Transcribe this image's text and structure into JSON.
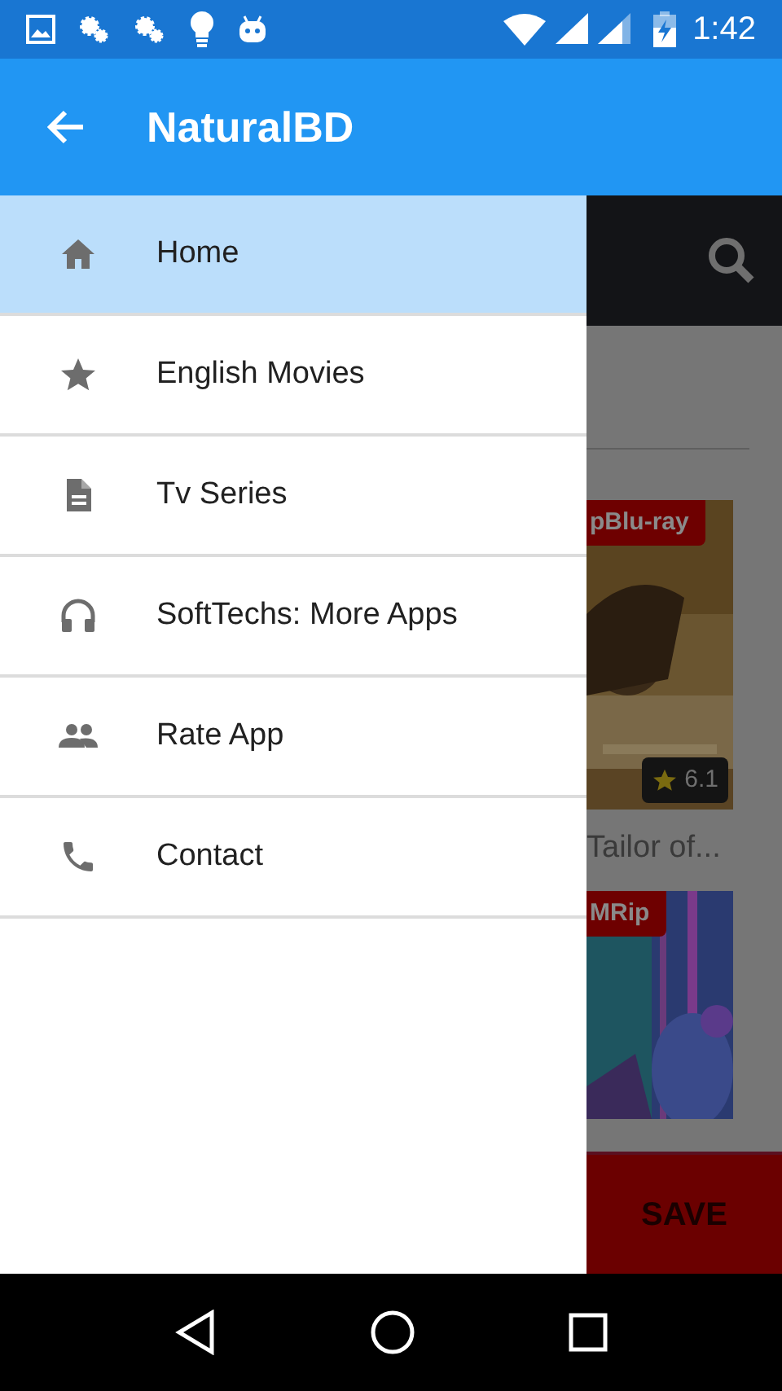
{
  "status_bar": {
    "time": "1:42"
  },
  "app_bar": {
    "title": "NaturalBD"
  },
  "drawer": {
    "items": [
      {
        "label": "Home",
        "selected": true
      },
      {
        "label": "English Movies",
        "selected": false
      },
      {
        "label": "Tv Series",
        "selected": false
      },
      {
        "label": "SoftTechs: More Apps",
        "selected": false
      },
      {
        "label": "Rate App",
        "selected": false
      },
      {
        "label": "Contact",
        "selected": false
      }
    ]
  },
  "background_screen": {
    "movies": [
      {
        "quality": "pBlu-ray",
        "rating": "6.1",
        "title": "Tailor of..."
      },
      {
        "quality": "MRip"
      }
    ],
    "save_button": "SAVE"
  }
}
